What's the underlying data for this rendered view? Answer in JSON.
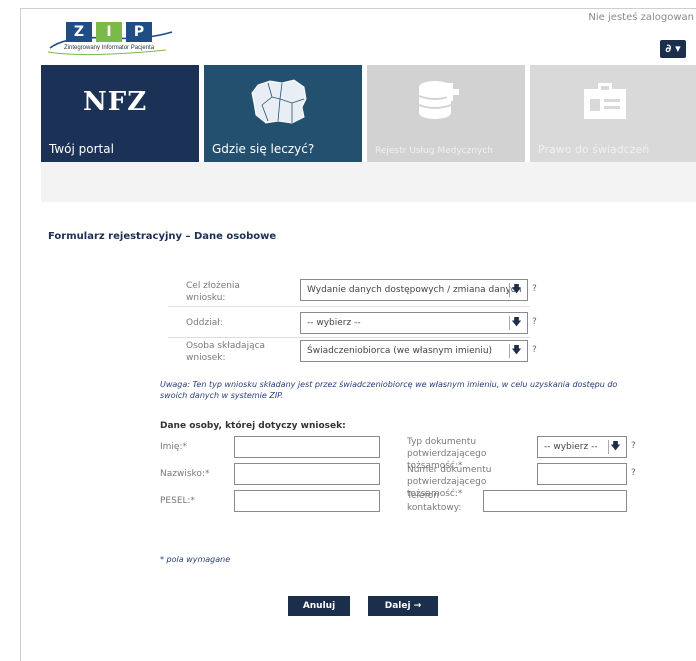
{
  "header": {
    "logo_letters": [
      "Z",
      "I",
      "P"
    ],
    "logo_subtitle": "Zintegrowany Informator Pacjenta",
    "login_status": "Nie jesteś zalogowan",
    "accessibility_button": "∂ ▾"
  },
  "tiles": [
    {
      "label": "Twój portal",
      "logo_text": "NFZ"
    },
    {
      "label": "Gdzie się leczyć?"
    },
    {
      "label": "Rejestr Usług Medycznych"
    },
    {
      "label": "Prawo do świadczeń"
    }
  ],
  "form": {
    "title": "Formularz rejestracyjny – Dane osobowe",
    "fields": [
      {
        "label": "Cel złożenia wniosku:",
        "value": "Wydanie danych dostępowych / zmiana danych"
      },
      {
        "label": "Oddział:",
        "value": "-- wybierz --"
      },
      {
        "label": "Osoba składająca wniosek:",
        "value": "Świadczeniobiorca (we własnym imieniu)"
      }
    ],
    "note": "Uwaga: Ten typ wniosku składany jest przez świadczeniobiorcę we własnym imieniu, w celu uzyskania dostępu do swoich danych w systemie ZIP.",
    "section_title": "Dane osoby, której dotyczy wniosek:",
    "left_fields": [
      {
        "label": "Imię:*",
        "value": ""
      },
      {
        "label": "Nazwisko:*",
        "value": ""
      },
      {
        "label": "PESEL:*",
        "value": ""
      }
    ],
    "right_fields": [
      {
        "label": "Typ dokumentu potwierdzającego tożsamość:*",
        "value": "-- wybierz --"
      },
      {
        "label": "Numer dokumentu potwierdzającego tożsamość:*",
        "value": ""
      },
      {
        "label": "Telefon kontaktowy:",
        "value": ""
      }
    ],
    "help_mark": "?",
    "required_note": "* pola wymagane",
    "cancel_label": "Anuluj",
    "next_label": "Dalej →"
  },
  "colors": {
    "navy": "#1b2e4b",
    "teal": "#23506f",
    "grey_tile": "#d2d2d2",
    "note_text": "#2a3d7a"
  }
}
